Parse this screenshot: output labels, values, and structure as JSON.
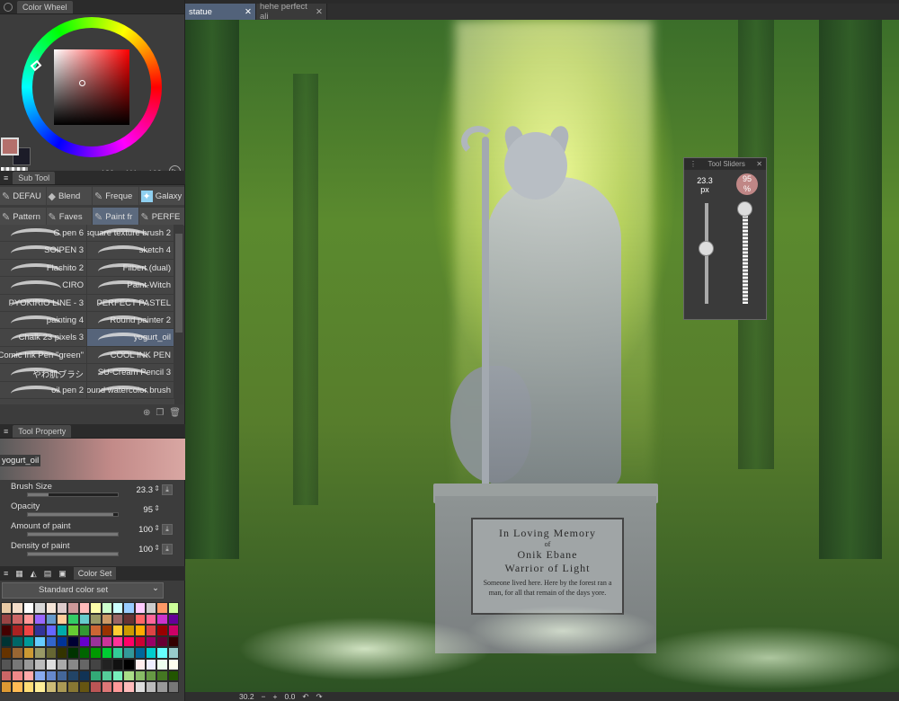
{
  "color_wheel": {
    "title": "Color Wheel",
    "r": "180",
    "g": "111",
    "b": "108",
    "fg_color": "#b4706c",
    "bg_color": "#1c1c28"
  },
  "sub_tool": {
    "title": "Sub Tool",
    "groups_row1": [
      "DEFAU",
      "Blend",
      "Freque",
      "Galaxy"
    ],
    "groups_row2": [
      "Pattern",
      "Faves",
      "Paint fr",
      "PERFE"
    ],
    "brushes": [
      [
        "G pen 6",
        "square texture brush 2"
      ],
      [
        "SOIPEN 3",
        "sketch 4"
      ],
      [
        "Flashito 2",
        "Filbert (dual)"
      ],
      [
        "CIRO",
        "Paint-Witch"
      ],
      [
        "PYOKIRIO LINE - 3",
        "PERFECT PASTEL"
      ],
      [
        "painting 4",
        "Round painter 2"
      ],
      [
        "Chalk 23 pixels 3",
        "yogurt_oil"
      ],
      [
        "Comic Ink Pen \"green\"",
        "COOL INK PEN"
      ],
      [
        "やわ肌ブラシ",
        "SU-Cream Pencil 3"
      ],
      [
        "oil pen 2",
        "Round watercolor brush"
      ]
    ]
  },
  "tool_property": {
    "title": "Tool Property",
    "brush_name": "yogurt_oil",
    "brush_size_label": "Brush Size",
    "brush_size_value": "23.3",
    "opacity_label": "Opacity",
    "opacity_value": "95",
    "amount_label": "Amount of paint",
    "amount_value": "100",
    "density_label": "Density of paint",
    "density_value": "100"
  },
  "color_set": {
    "tab_label": "Color Set",
    "set_name": "Standard color set",
    "swatches": [
      "#e8c9a4",
      "#f4dcc8",
      "#fff",
      "#d8d8d8",
      "#f5e5d8",
      "#dcc",
      "#c99",
      "#fbb",
      "#ffa",
      "#cfc",
      "#cff",
      "#9cf",
      "#fcf",
      "#ccc",
      "#f96",
      "#cf9",
      "#944",
      "#c66",
      "#f99",
      "#96f",
      "#69c",
      "#fc9",
      "#3c6",
      "#6cc",
      "#996",
      "#c96",
      "#966",
      "#633",
      "#f66",
      "#f69",
      "#c3c",
      "#609",
      "#400",
      "#a22",
      "#e44",
      "#339",
      "#66f",
      "#0aa",
      "#6c3",
      "#393",
      "#c63",
      "#930",
      "#fc3",
      "#c90",
      "#fa0",
      "#d44",
      "#900",
      "#c06",
      "#033",
      "#066",
      "#099",
      "#6cf",
      "#36c",
      "#039",
      "#003",
      "#60c",
      "#939",
      "#c39",
      "#f39",
      "#f06",
      "#c03",
      "#906",
      "#603",
      "#300",
      "#630",
      "#963",
      "#c93",
      "#996",
      "#663",
      "#330",
      "#030",
      "#060",
      "#090",
      "#0c3",
      "#3c9",
      "#399",
      "#069",
      "#0cc",
      "#6ff",
      "#9cc",
      "#555",
      "#777",
      "#999",
      "#bbb",
      "#ddd",
      "#aaa",
      "#888",
      "#666",
      "#444",
      "#222",
      "#111",
      "#000",
      "#fee",
      "#eef",
      "#efe",
      "#ffe",
      "#c66",
      "#e88",
      "#faa",
      "#8ae",
      "#68c",
      "#469",
      "#246",
      "#135",
      "#3a7",
      "#5c9",
      "#7eb",
      "#ad8",
      "#8b6",
      "#694",
      "#472",
      "#250",
      "#d93",
      "#fb5",
      "#fd7",
      "#fe9",
      "#cb7",
      "#a95",
      "#873",
      "#651",
      "#b55",
      "#d77",
      "#f99",
      "#fbb",
      "#ddd",
      "#bbb",
      "#999",
      "#777"
    ]
  },
  "tabs": {
    "tab1": "statue",
    "tab2": "hehe perfect ali"
  },
  "plaque": {
    "line1": "In Loving Memory",
    "line2": "of",
    "line3": "Onik Ebane",
    "line4": "Warrior of Light",
    "line5": "Someone lived here. Here by the forest ran a man, for all that remain of the days yore."
  },
  "tool_slider": {
    "title": "Tool Sliders",
    "size": "23.3",
    "size_unit": "px",
    "opacity": "95",
    "opacity_unit": "%"
  },
  "bottom": {
    "zoom": "30.2",
    "angle": "0.0"
  }
}
